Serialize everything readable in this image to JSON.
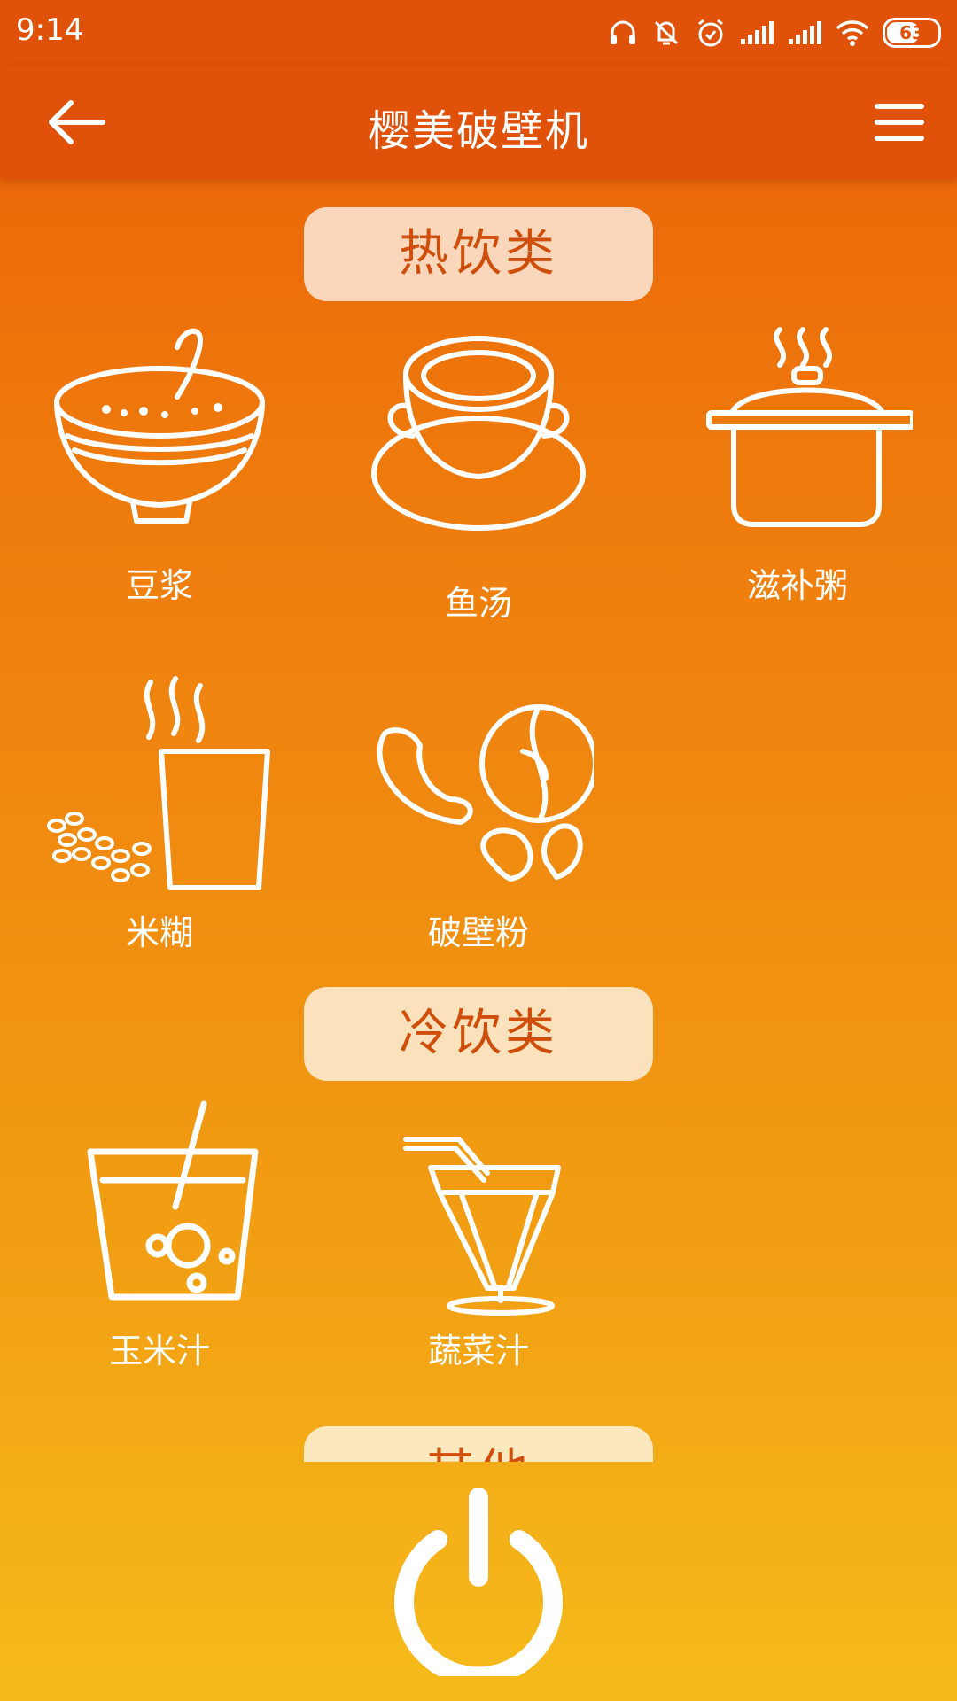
{
  "status_bar": {
    "time": "9:14",
    "battery": "63"
  },
  "app_bar": {
    "title": "樱美破壁机",
    "back_icon": "arrow-left-icon",
    "menu_icon": "hamburger-menu-icon"
  },
  "categories": {
    "hot": {
      "label": "热饮类",
      "items": [
        {
          "label": "豆浆",
          "icon": "soy-milk-bowl-icon"
        },
        {
          "label": "鱼汤",
          "icon": "soup-tureen-icon"
        },
        {
          "label": "滋补粥",
          "icon": "steaming-pot-icon"
        },
        {
          "label": "米糊",
          "icon": "rice-paste-cup-icon"
        },
        {
          "label": "破壁粉",
          "icon": "nuts-powder-icon"
        }
      ]
    },
    "cold": {
      "label": "冷饮类",
      "items": [
        {
          "label": "玉米汁",
          "icon": "corn-juice-glass-icon"
        },
        {
          "label": "蔬菜汁",
          "icon": "vegetable-juice-glass-icon"
        }
      ]
    },
    "other": {
      "label": "其他"
    }
  },
  "power_button": {
    "icon": "power-icon"
  },
  "colors": {
    "header": "#e0520a",
    "gradient_top": "#ea5f08",
    "gradient_bottom": "#f6bb1b",
    "label_text": "#cf4e0c"
  }
}
